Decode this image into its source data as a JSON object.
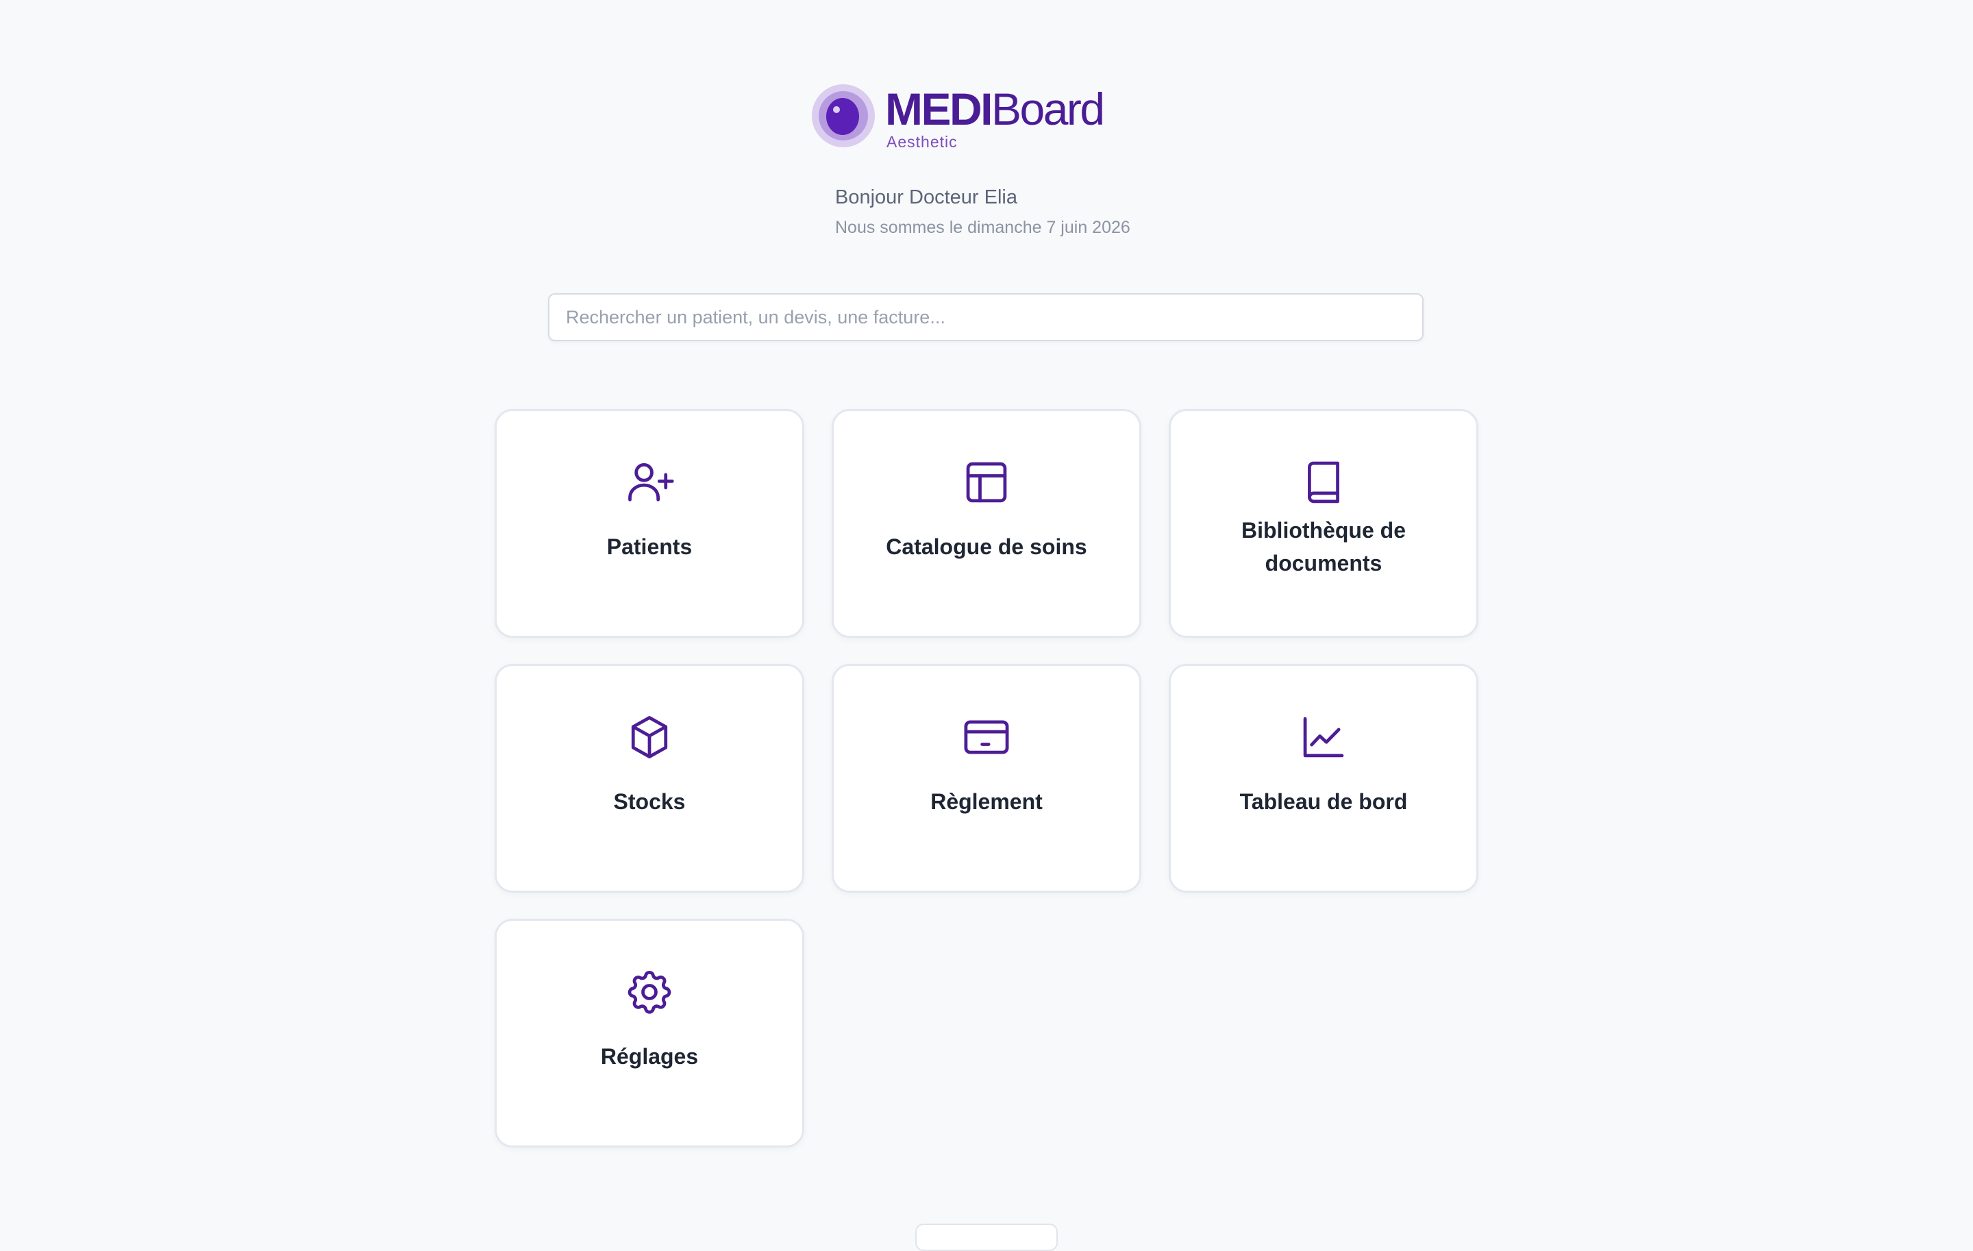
{
  "brand": {
    "name_bold": "MEDI",
    "name_light": "Board",
    "subtitle": "Aesthetic",
    "accent_color": "#4a1d96",
    "logo_icon": "eye-lens-logo"
  },
  "greeting": {
    "title": "Bonjour Docteur Elia",
    "date": "Nous sommes le dimanche 7 juin 2026"
  },
  "search": {
    "placeholder": "Rechercher un patient, un devis, une facture..."
  },
  "modules": [
    {
      "label": "Patients",
      "icon": "user-plus-icon"
    },
    {
      "label": "Catalogue de soins",
      "icon": "layout-table-icon"
    },
    {
      "label": "Bibliothèque de documents",
      "icon": "book-icon"
    },
    {
      "label": "Stocks",
      "icon": "package-box-icon"
    },
    {
      "label": "Règlement",
      "icon": "credit-card-icon"
    },
    {
      "label": "Tableau de bord",
      "icon": "line-chart-icon"
    },
    {
      "label": "Réglages",
      "icon": "gear-icon"
    }
  ]
}
